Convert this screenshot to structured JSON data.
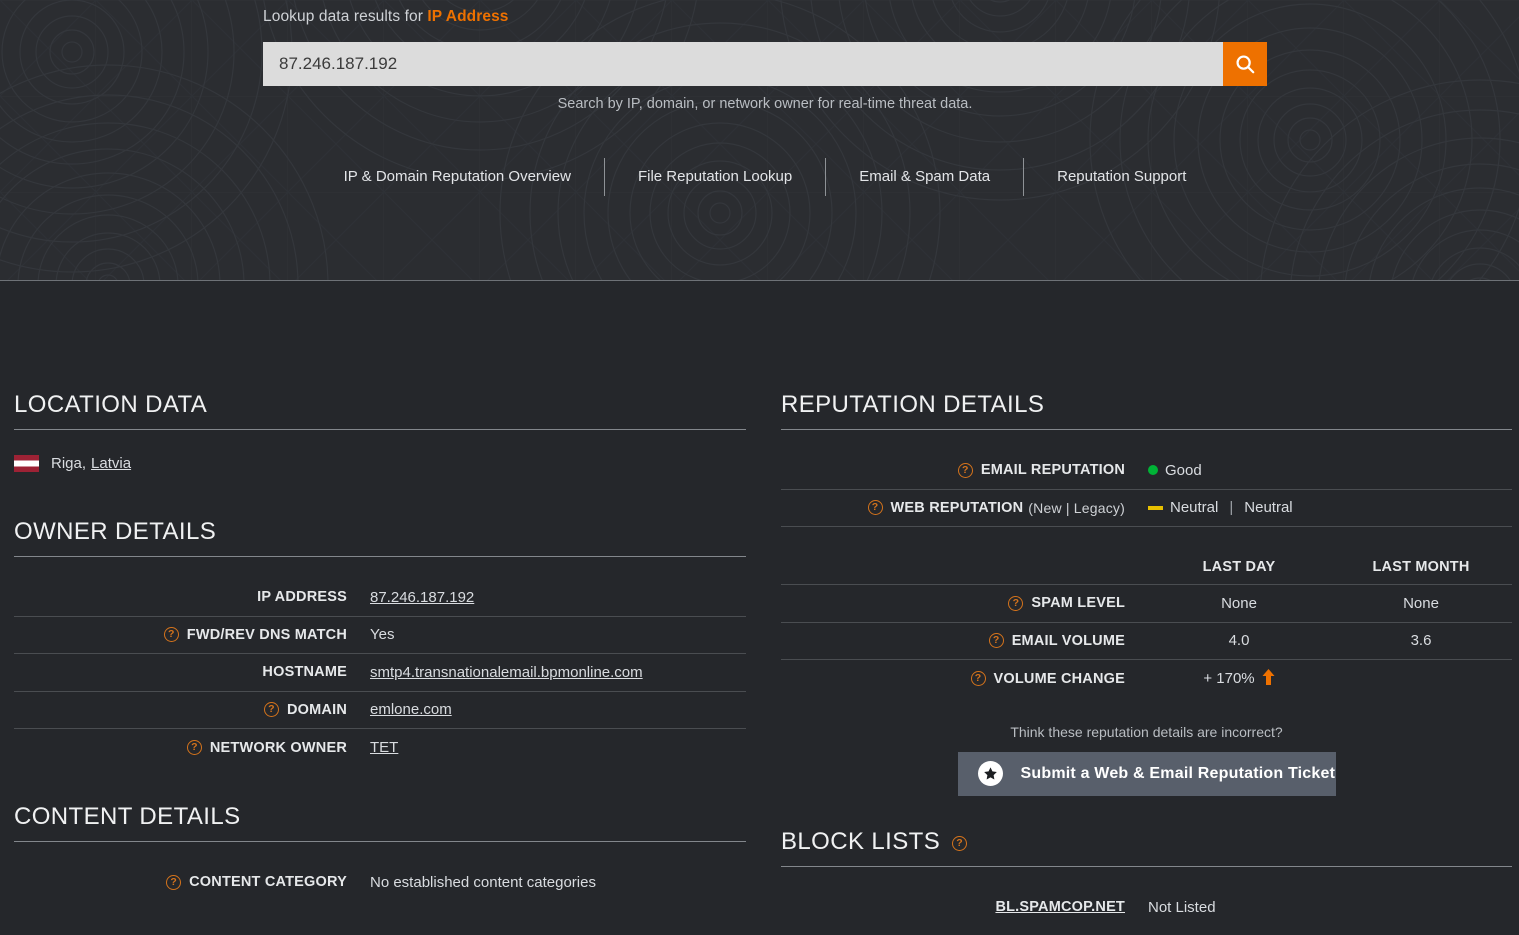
{
  "header": {
    "lookup_prefix": "Lookup data results for ",
    "lookup_target": "IP Address",
    "search_value": "87.246.187.192",
    "search_placeholder": "Search by IP, domain, or network owner",
    "search_icon": "search-icon",
    "hint": "Search by IP, domain, or network owner for real-time threat data.",
    "tabs": [
      {
        "label": "IP & Domain Reputation Overview"
      },
      {
        "label": "File Reputation Lookup"
      },
      {
        "label": "Email & Spam Data"
      },
      {
        "label": "Reputation Support"
      }
    ]
  },
  "location": {
    "title": "LOCATION DATA",
    "city": "Riga,",
    "country": "Latvia",
    "flag_icon": "latvia-flag-icon"
  },
  "owner": {
    "title": "OWNER DETAILS",
    "rows": [
      {
        "label": "IP ADDRESS",
        "value": "87.246.187.192",
        "help": false,
        "link": true
      },
      {
        "label": "FWD/REV DNS MATCH",
        "value": "Yes",
        "help": true,
        "link": false
      },
      {
        "label": "HOSTNAME",
        "value": "smtp4.transnationalemail.bpmonline.com",
        "help": false,
        "link": true
      },
      {
        "label": "DOMAIN",
        "value": "emlone.com",
        "help": true,
        "link": true
      },
      {
        "label": "NETWORK OWNER",
        "value": "TET",
        "help": true,
        "link": true
      }
    ]
  },
  "content": {
    "title": "CONTENT DETAILS",
    "rows": [
      {
        "label": "CONTENT CATEGORY",
        "value": "No established content categories",
        "help": true
      }
    ]
  },
  "reputation": {
    "title": "REPUTATION DETAILS",
    "email": {
      "label": "EMAIL REPUTATION",
      "value": "Good",
      "indicator": "green-dot-icon",
      "indicator_color": "#00b336"
    },
    "web": {
      "label": "WEB REPUTATION",
      "sublabel": "(New | Legacy)",
      "value_new": "Neutral",
      "value_legacy": "Neutral",
      "separator": "|",
      "indicator": "yellow-dash-icon",
      "indicator_color": "#e8c000"
    },
    "columns": [
      "LAST DAY",
      "LAST MONTH"
    ],
    "stats": [
      {
        "label": "SPAM LEVEL",
        "last_day": "None",
        "last_month": "None",
        "arrow": false
      },
      {
        "label": "EMAIL VOLUME",
        "last_day": "4.0",
        "last_month": "3.6",
        "arrow": false
      },
      {
        "label": "VOLUME CHANGE",
        "last_day": "+ 170%",
        "last_month": "",
        "arrow": true,
        "arrow_icon": "arrow-up-icon",
        "arrow_color": "#ee7100"
      }
    ],
    "ticket_question": "Think these reputation details are incorrect?",
    "ticket_button": "Submit a Web & Email Reputation Ticket",
    "ticket_icon": "star-icon"
  },
  "block_lists": {
    "title": "BLOCK LISTS",
    "rows": [
      {
        "name": "BL.SPAMCOP.NET",
        "status": "Not Listed"
      }
    ]
  },
  "colors": {
    "accent_orange": "#ee7100",
    "help_orange": "#d4731c",
    "good_green": "#00b336",
    "neutral_yellow": "#e8c000",
    "header_bg": "#2b2d31",
    "body_bg": "#25272b",
    "button_slate": "#585f6b"
  }
}
